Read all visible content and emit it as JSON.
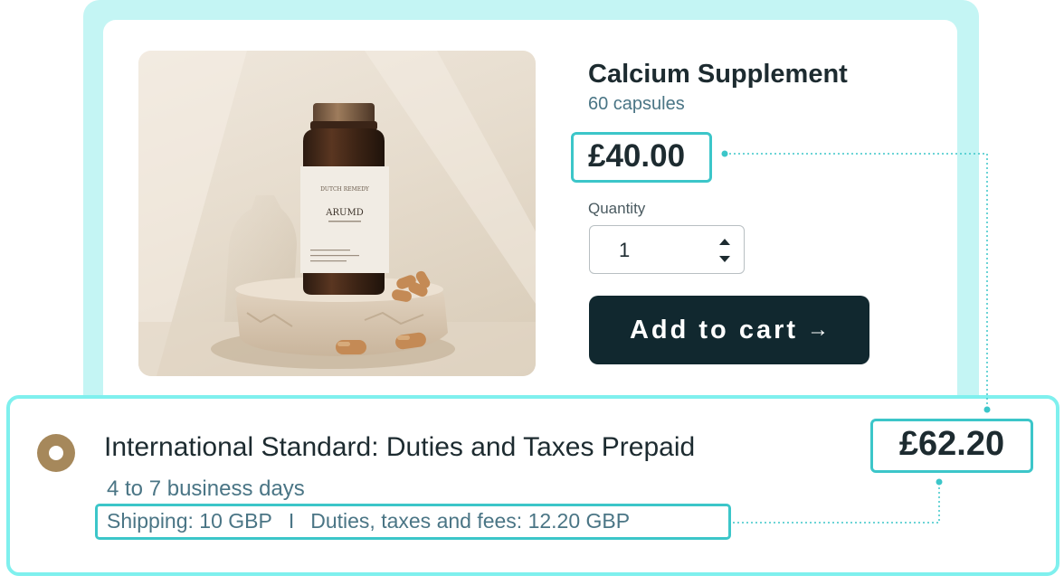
{
  "product": {
    "title": "Calcium Supplement",
    "size": "60 capsules",
    "price": "£40.00",
    "quantity_label": "Quantity",
    "quantity_value": "1",
    "add_to_cart_label": "Add to cart",
    "add_to_cart_arrow": "→",
    "bottle_brand": "DUTCH REMEDY",
    "bottle_name": "ARUMD"
  },
  "shipping_option": {
    "title": "International Standard: Duties and Taxes Prepaid",
    "delivery_time": "4 to 7 business days",
    "shipping_cost": "Shipping: 10 GBP",
    "separator": "I",
    "duties_cost": "Duties, taxes and fees: 12.20 GBP",
    "total": "£62.20",
    "selected": true
  },
  "colors": {
    "accent_teal": "#3cc6c9",
    "frame_mint": "#c4f5f4",
    "button_dark": "#11282f",
    "radio_gold": "#a6885b",
    "muted_text": "#4a7585"
  }
}
